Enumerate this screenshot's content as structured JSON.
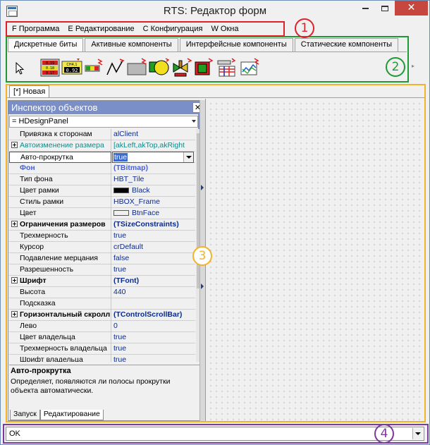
{
  "window": {
    "title": "RTS: Редактор форм",
    "minimize_icon": "minimize-icon",
    "maximize_icon": "maximize-icon",
    "close_icon": "close-icon",
    "close_glyph": "✕"
  },
  "menu": {
    "items": [
      "F Программа",
      "E Редактирование",
      "C Конфигурация",
      "W Окна"
    ]
  },
  "palette": {
    "tabs": [
      "Дискретные биты",
      "Активные компоненты",
      "Интерфейсные компоненты",
      "Статические компоненты"
    ],
    "tool_icons": [
      "pointer-icon",
      "digital-display-icon",
      "analog-value-icon",
      "bar-indicator-icon",
      "line-icon",
      "panel-icon",
      "polygon-shape-icon",
      "valve-icon",
      "button-icon",
      "table-icon",
      "trend-icon"
    ],
    "scroll_glyph": "▸"
  },
  "tool_labels": {
    "display_lines": [
      "0.19",
      "0.18",
      "0.17"
    ],
    "analog_top": "CH4,1",
    "analog_value": "0.92"
  },
  "form": {
    "tab_label": "[*] Новая"
  },
  "inspector": {
    "title": "Инспектор объектов",
    "close_glyph": "✕",
    "selected_object": "= HDesignPanel",
    "edit_value": "true",
    "rows": [
      {
        "name": "Привязка к сторонам",
        "value": "alClient"
      },
      {
        "name": "Автоизменение размера",
        "value": "[akLeft,akTop,akRight"
      },
      {
        "name": "Авто-прокрутка",
        "value": "true"
      },
      {
        "name": "Фон",
        "value": "(TBitmap)"
      },
      {
        "name": "Тип фона",
        "value": "HBT_Tile"
      },
      {
        "name": "Цвет рамки",
        "value": "Black"
      },
      {
        "name": "Стиль рамки",
        "value": "HBOX_Frame"
      },
      {
        "name": "Цвет",
        "value": "BtnFace"
      },
      {
        "name": "Ограничения размеров",
        "value": "(TSizeConstraints)"
      },
      {
        "name": "Трехмерность",
        "value": "true"
      },
      {
        "name": "Курсор",
        "value": "crDefault"
      },
      {
        "name": "Подавление мерцания",
        "value": "false"
      },
      {
        "name": "Разрешенность",
        "value": "true"
      },
      {
        "name": "Шрифт",
        "value": "(TFont)"
      },
      {
        "name": "Высота",
        "value": "440"
      },
      {
        "name": "Подсказка",
        "value": ""
      },
      {
        "name": "Горизонтальный скроллинг",
        "value": "(TControlScrollBar)"
      },
      {
        "name": "Лево",
        "value": "0"
      },
      {
        "name": "Цвет владельца",
        "value": "true"
      },
      {
        "name": "Трехмерность владельца",
        "value": "true"
      },
      {
        "name": "Шрифт владельца",
        "value": "true"
      }
    ],
    "description": {
      "title": "Авто-прокрутка",
      "text": "Определяет, появляются ли полосы прокрутки объекта автоматически."
    },
    "bottom_tabs": [
      "Запуск",
      "Редактирование"
    ]
  },
  "status": {
    "value": "OK"
  },
  "annotations": [
    "1",
    "2",
    "3",
    "4"
  ],
  "colors": {
    "annotation_menu": "#e0212b",
    "annotation_palette": "#1f9a32",
    "annotation_workspace": "#f2b32a",
    "annotation_status": "#7a3aa0",
    "inspector_header": "#7a8ec7",
    "value_text": "#0a2a8c",
    "swatch_black": "#000000",
    "swatch_btnface": "#f0f0f0"
  }
}
